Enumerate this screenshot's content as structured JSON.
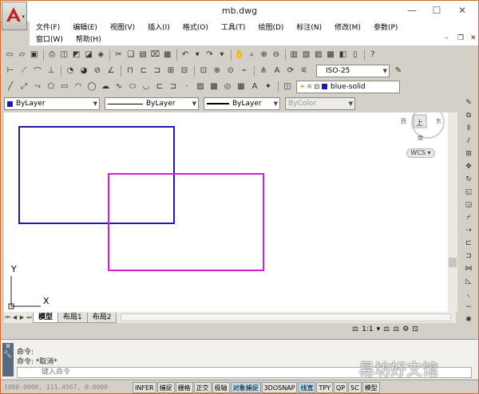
{
  "window": {
    "title": "mb.dwg",
    "minimize": "—",
    "maximize": "☐",
    "close": "✕"
  },
  "menu": {
    "row1": [
      "文件(F)",
      "编辑(E)",
      "视图(V)",
      "插入(I)",
      "格式(O)",
      "工具(T)",
      "绘图(D)",
      "标注(N)",
      "修改(M)",
      "参数(P)"
    ],
    "row2": [
      "窗口(W)",
      "帮助(H)"
    ]
  },
  "toolbar": {
    "dimstyle": "ISO-25",
    "layer": "blue-solid"
  },
  "properties": {
    "color": "ByLayer",
    "linetype": "ByLayer",
    "lineweight": "ByLayer",
    "plotstyle": "ByColor"
  },
  "viewcube": {
    "north": "北",
    "south": "南",
    "west": "西",
    "east": "东",
    "face": "上",
    "wcs": "WCS"
  },
  "ucs": {
    "x": "X",
    "y": "Y"
  },
  "tabs": {
    "model": "模型",
    "layout1": "布局1",
    "layout2": "布局2"
  },
  "annot_scale": "1:1",
  "command": {
    "line1": "命令:",
    "line2": "命令: *取消*",
    "placeholder": "键入命令",
    "side_close": "✕"
  },
  "status": {
    "coords": "1000.0000, 111.4567, 0.0000",
    "buttons": [
      "INFER",
      "捕捉",
      "栅格",
      "正交",
      "极轴",
      "对象捕捉",
      "3DOSNAP",
      "线宽",
      "TPY",
      "QP",
      "SC",
      "模型"
    ],
    "active": [
      "对象捕捉",
      "线宽"
    ]
  },
  "watermark": "易坊好文馆",
  "colors": {
    "blue_rect": "#1c1ca8",
    "magenta_rect": "#d41ed4",
    "accent": "#c96b2e"
  }
}
